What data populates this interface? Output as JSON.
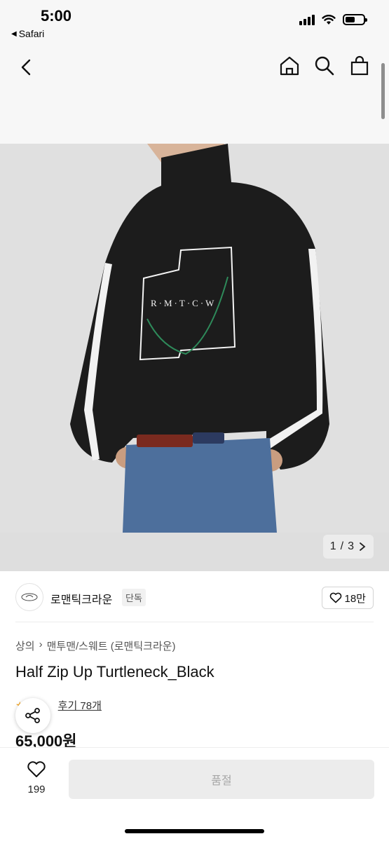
{
  "status_bar": {
    "time": "5:00",
    "back_app": "Safari",
    "icons": [
      "cellular-signal-icon",
      "wifi-icon",
      "battery-icon"
    ]
  },
  "nav": {
    "icons": [
      "back-chevron-icon",
      "home-icon",
      "search-icon",
      "shopping-bag-icon"
    ]
  },
  "gallery": {
    "current": "1",
    "separator": "/",
    "total": "3",
    "next_icon": "chevron-right-icon"
  },
  "brand": {
    "name": "로맨틱크라운",
    "badge": "단독",
    "like_count": "18만"
  },
  "breadcrumb": {
    "items": [
      "상의",
      "맨투맨/스웨트 (로맨틱크라운)"
    ]
  },
  "product": {
    "title": "Half Zip Up Turtleneck_Black",
    "review_text": "후기 78개",
    "price": "65,000원"
  },
  "bottom_bar": {
    "wish_count": "199",
    "buy_button_label": "품절"
  },
  "colors": {
    "background": "#ffffff",
    "nav_background": "#f7f7f7",
    "hero_background": "#dfdfdf",
    "disabled_button": "#ececec",
    "star": "#f5a623"
  }
}
